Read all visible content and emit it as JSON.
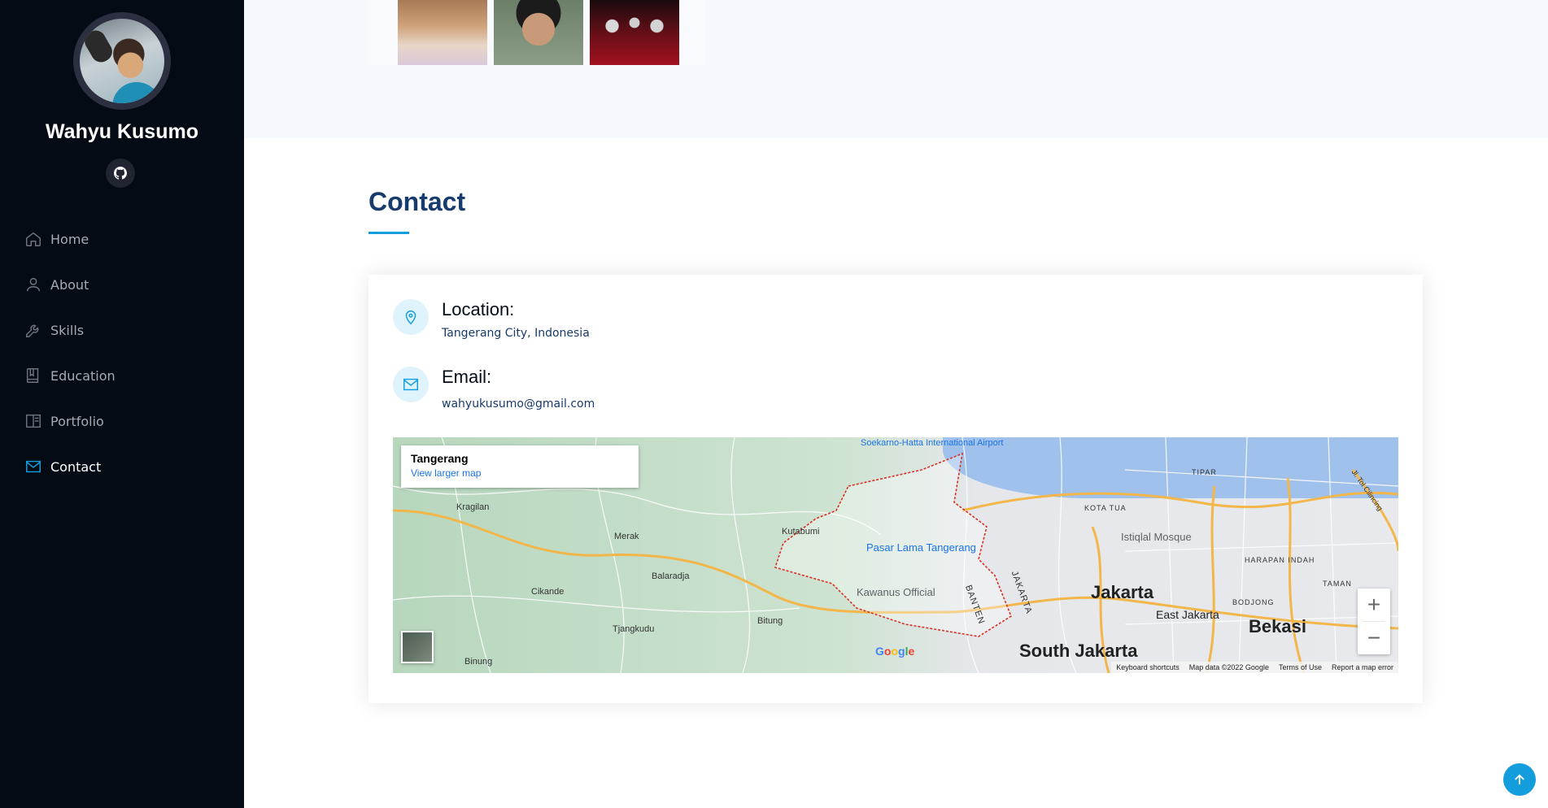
{
  "sidebar": {
    "name": "Wahyu Kusumo",
    "social": [
      {
        "icon": "github-icon"
      }
    ],
    "nav": [
      {
        "label": "Home",
        "icon": "home-icon",
        "active": false
      },
      {
        "label": "About",
        "icon": "user-icon",
        "active": false
      },
      {
        "label": "Skills",
        "icon": "wrench-icon",
        "active": false
      },
      {
        "label": "Education",
        "icon": "book-icon",
        "active": false
      },
      {
        "label": "Portfolio",
        "icon": "book-open-icon",
        "active": false
      },
      {
        "label": "Contact",
        "icon": "envelope-icon",
        "active": true
      }
    ]
  },
  "contact": {
    "title": "Contact",
    "location": {
      "heading": "Location:",
      "value": "Tangerang City, Indonesia"
    },
    "email": {
      "heading": "Email:",
      "value": "wahyukusumo@gmail.com"
    }
  },
  "map": {
    "place_title": "Tangerang",
    "larger_map_link": "View larger map",
    "labels": {
      "airport": "Soekarno-Hatta International Airport",
      "kragilan": "Kragilan",
      "merak": "Merak",
      "kutabumi": "Kutabumi",
      "balaradja": "Balaradja",
      "cikande": "Cikande",
      "tjangkudu": "Tjangkudu",
      "bitung": "Bitung",
      "binung": "Binung",
      "pasar_lama": "Pasar Lama Tangerang",
      "kawanus": "Kawanus Official",
      "istiqlal": "Istiqlal Mosque",
      "kota_tua": "KOTA TUA",
      "tipar": "TIPAR",
      "harapan_indah": "HARAPAN INDAH",
      "taman": "TAMAN",
      "bodjong": "BODJONG",
      "jakarta": "Jakarta",
      "east_jakarta": "East Jakarta",
      "bekasi": "Bekasi",
      "south_jakarta": "South Jakarta",
      "jakarta_border": "JAKARTA",
      "banten_border": "BANTEN",
      "cilincing": "Jl. Tol Cilincing"
    },
    "zoom_in": "+",
    "zoom_out": "−",
    "google": "Google",
    "footer": {
      "shortcuts": "Keyboard shortcuts",
      "mapdata": "Map data ©2022 Google",
      "terms": "Terms of Use",
      "report": "Report a map error"
    }
  },
  "colors": {
    "accent": "#149ddd",
    "sidebar_bg": "#040b14",
    "title": "#173b6c"
  }
}
